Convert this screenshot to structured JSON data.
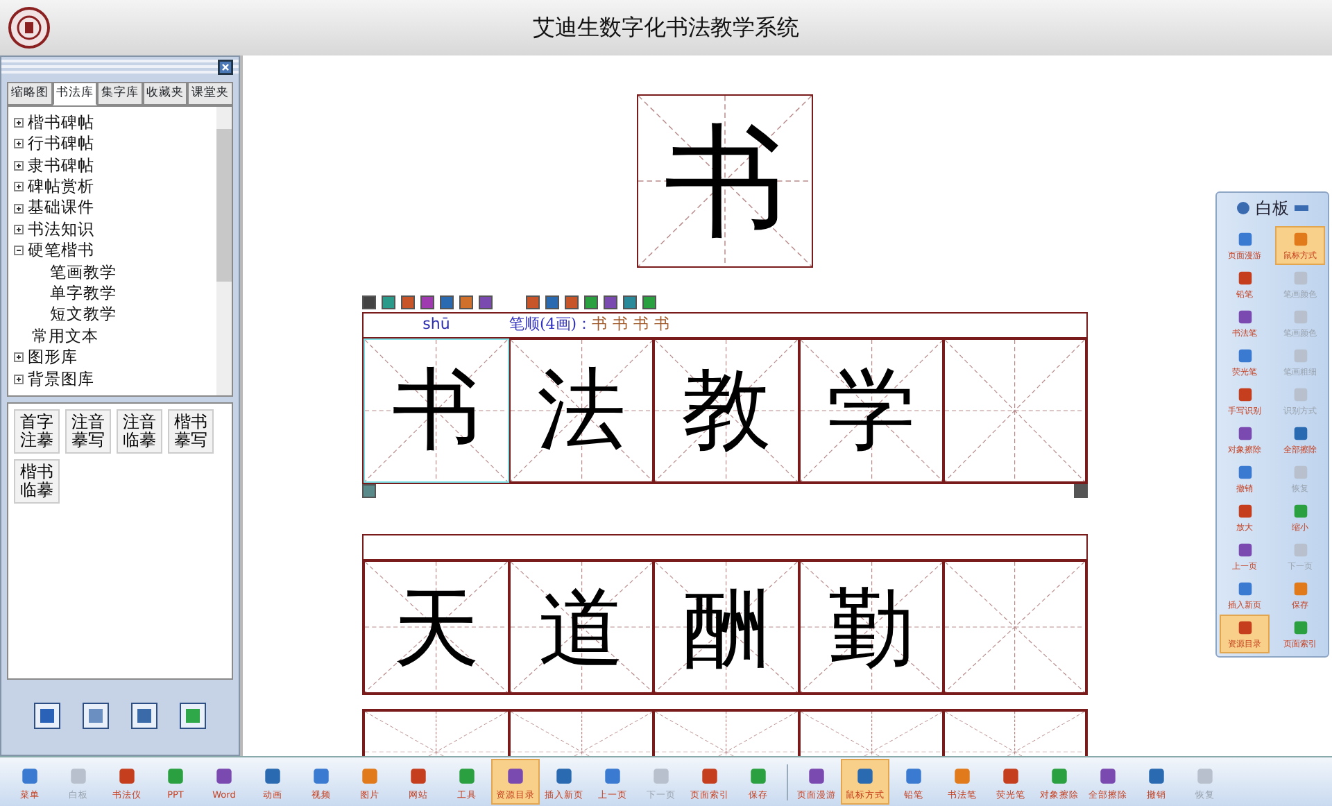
{
  "window": {
    "title": "艾迪生数字化书法教学系统"
  },
  "sidebar": {
    "tabs": [
      {
        "label": "缩略图",
        "selected": false
      },
      {
        "label": "书法库",
        "selected": true
      },
      {
        "label": "集字库",
        "selected": false
      },
      {
        "label": "收藏夹",
        "selected": false
      },
      {
        "label": "课堂夹",
        "selected": false
      }
    ],
    "tree": [
      {
        "label": "楷书碑帖",
        "expanded": false
      },
      {
        "label": "行书碑帖",
        "expanded": false
      },
      {
        "label": "隶书碑帖",
        "expanded": false
      },
      {
        "label": "碑帖赏析",
        "expanded": false
      },
      {
        "label": "基础课件",
        "expanded": false
      },
      {
        "label": "书法知识",
        "expanded": false
      },
      {
        "label": "硬笔楷书",
        "expanded": true,
        "children": [
          {
            "label": "笔画教学"
          },
          {
            "label": "单字教学"
          },
          {
            "label": "短文教学"
          }
        ]
      },
      {
        "label": "常用文本",
        "kind": "leaf"
      },
      {
        "label": "图形库",
        "expanded": false
      },
      {
        "label": "背景图库",
        "expanded": false
      }
    ],
    "modes": [
      {
        "line1": "首字",
        "line2": "注摹"
      },
      {
        "line1": "注音",
        "line2": "摹写"
      },
      {
        "line1": "注音",
        "line2": "临摹"
      },
      {
        "line1": "楷书",
        "line2": "摹写"
      },
      {
        "line1": "楷书",
        "line2": "临摹"
      }
    ]
  },
  "canvas": {
    "big_character": "书",
    "practice": {
      "pinyin": "shū",
      "stroke_order_label": "笔顺(4画)：",
      "stroke_steps": [
        "书",
        "书",
        "书",
        "书"
      ],
      "characters": [
        "书",
        "法",
        "教",
        "学"
      ]
    },
    "second_practice": {
      "characters": [
        "天",
        "道",
        "酬",
        "勤"
      ]
    }
  },
  "whiteboard": {
    "title": "白板",
    "tools": [
      {
        "label": "页面漫游",
        "selected": false,
        "disabled": false
      },
      {
        "label": "鼠标方式",
        "selected": true,
        "disabled": false
      },
      {
        "label": "铅笔",
        "selected": false,
        "disabled": false
      },
      {
        "label": "笔画颜色",
        "selected": false,
        "disabled": true
      },
      {
        "label": "书法笔",
        "selected": false,
        "disabled": false
      },
      {
        "label": "笔画颜色",
        "selected": false,
        "disabled": true
      },
      {
        "label": "荧光笔",
        "selected": false,
        "disabled": false
      },
      {
        "label": "笔画粗细",
        "selected": false,
        "disabled": true
      },
      {
        "label": "手写识别",
        "selected": false,
        "disabled": false
      },
      {
        "label": "识别方式",
        "selected": false,
        "disabled": true
      },
      {
        "label": "对象擦除",
        "selected": false,
        "disabled": false
      },
      {
        "label": "全部擦除",
        "selected": false,
        "disabled": false
      },
      {
        "label": "撤销",
        "selected": false,
        "disabled": false
      },
      {
        "label": "恢复",
        "selected": false,
        "disabled": true
      },
      {
        "label": "放大",
        "selected": false,
        "disabled": false
      },
      {
        "label": "缩小",
        "selected": false,
        "disabled": false
      },
      {
        "label": "上一页",
        "selected": false,
        "disabled": false
      },
      {
        "label": "下一页",
        "selected": false,
        "disabled": true
      },
      {
        "label": "插入新页",
        "selected": false,
        "disabled": false
      },
      {
        "label": "保存",
        "selected": false,
        "disabled": false
      },
      {
        "label": "资源目录",
        "selected": true,
        "disabled": false
      },
      {
        "label": "页面索引",
        "selected": false,
        "disabled": false
      }
    ]
  },
  "toolbar": [
    {
      "label": "菜单",
      "selected": false,
      "disabled": false
    },
    {
      "label": "白板",
      "selected": false,
      "disabled": true
    },
    {
      "label": "书法仪",
      "selected": false,
      "disabled": false
    },
    {
      "label": "PPT",
      "selected": false,
      "disabled": false
    },
    {
      "label": "Word",
      "selected": false,
      "disabled": false
    },
    {
      "label": "动画",
      "selected": false,
      "disabled": false
    },
    {
      "label": "视频",
      "selected": false,
      "disabled": false
    },
    {
      "label": "图片",
      "selected": false,
      "disabled": false
    },
    {
      "label": "网站",
      "selected": false,
      "disabled": false
    },
    {
      "label": "工具",
      "selected": false,
      "disabled": false
    },
    {
      "label": "资源目录",
      "selected": true,
      "disabled": false
    },
    {
      "label": "插入新页",
      "selected": false,
      "disabled": false
    },
    {
      "label": "上一页",
      "selected": false,
      "disabled": false
    },
    {
      "label": "下一页",
      "selected": false,
      "disabled": true
    },
    {
      "label": "页面索引",
      "selected": false,
      "disabled": false
    },
    {
      "label": "保存",
      "selected": false,
      "disabled": false
    },
    {
      "label": "页面漫游",
      "selected": false,
      "disabled": false
    },
    {
      "label": "鼠标方式",
      "selected": true,
      "disabled": false
    },
    {
      "label": "铅笔",
      "selected": false,
      "disabled": false
    },
    {
      "label": "书法笔",
      "selected": false,
      "disabled": false
    },
    {
      "label": "荧光笔",
      "selected": false,
      "disabled": false
    },
    {
      "label": "对象擦除",
      "selected": false,
      "disabled": false
    },
    {
      "label": "全部擦除",
      "selected": false,
      "disabled": false
    },
    {
      "label": "撤销",
      "selected": false,
      "disabled": false
    },
    {
      "label": "恢复",
      "selected": false,
      "disabled": true
    }
  ]
}
